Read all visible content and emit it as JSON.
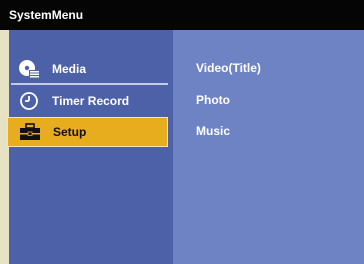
{
  "title": "SystemMenu",
  "menu": {
    "items": [
      {
        "label": "Media",
        "icon": "media-icon"
      },
      {
        "label": "Timer Record",
        "icon": "clock-icon"
      },
      {
        "label": "Setup",
        "icon": "toolbox-icon",
        "selected": true
      }
    ]
  },
  "submenu": {
    "items": [
      "Video(Title)",
      "Photo",
      "Music"
    ]
  },
  "colors": {
    "titlebar": "#050505",
    "sidebar": "#4d61a8",
    "content": "#6d83c4",
    "highlight": "#e7ad1f"
  }
}
